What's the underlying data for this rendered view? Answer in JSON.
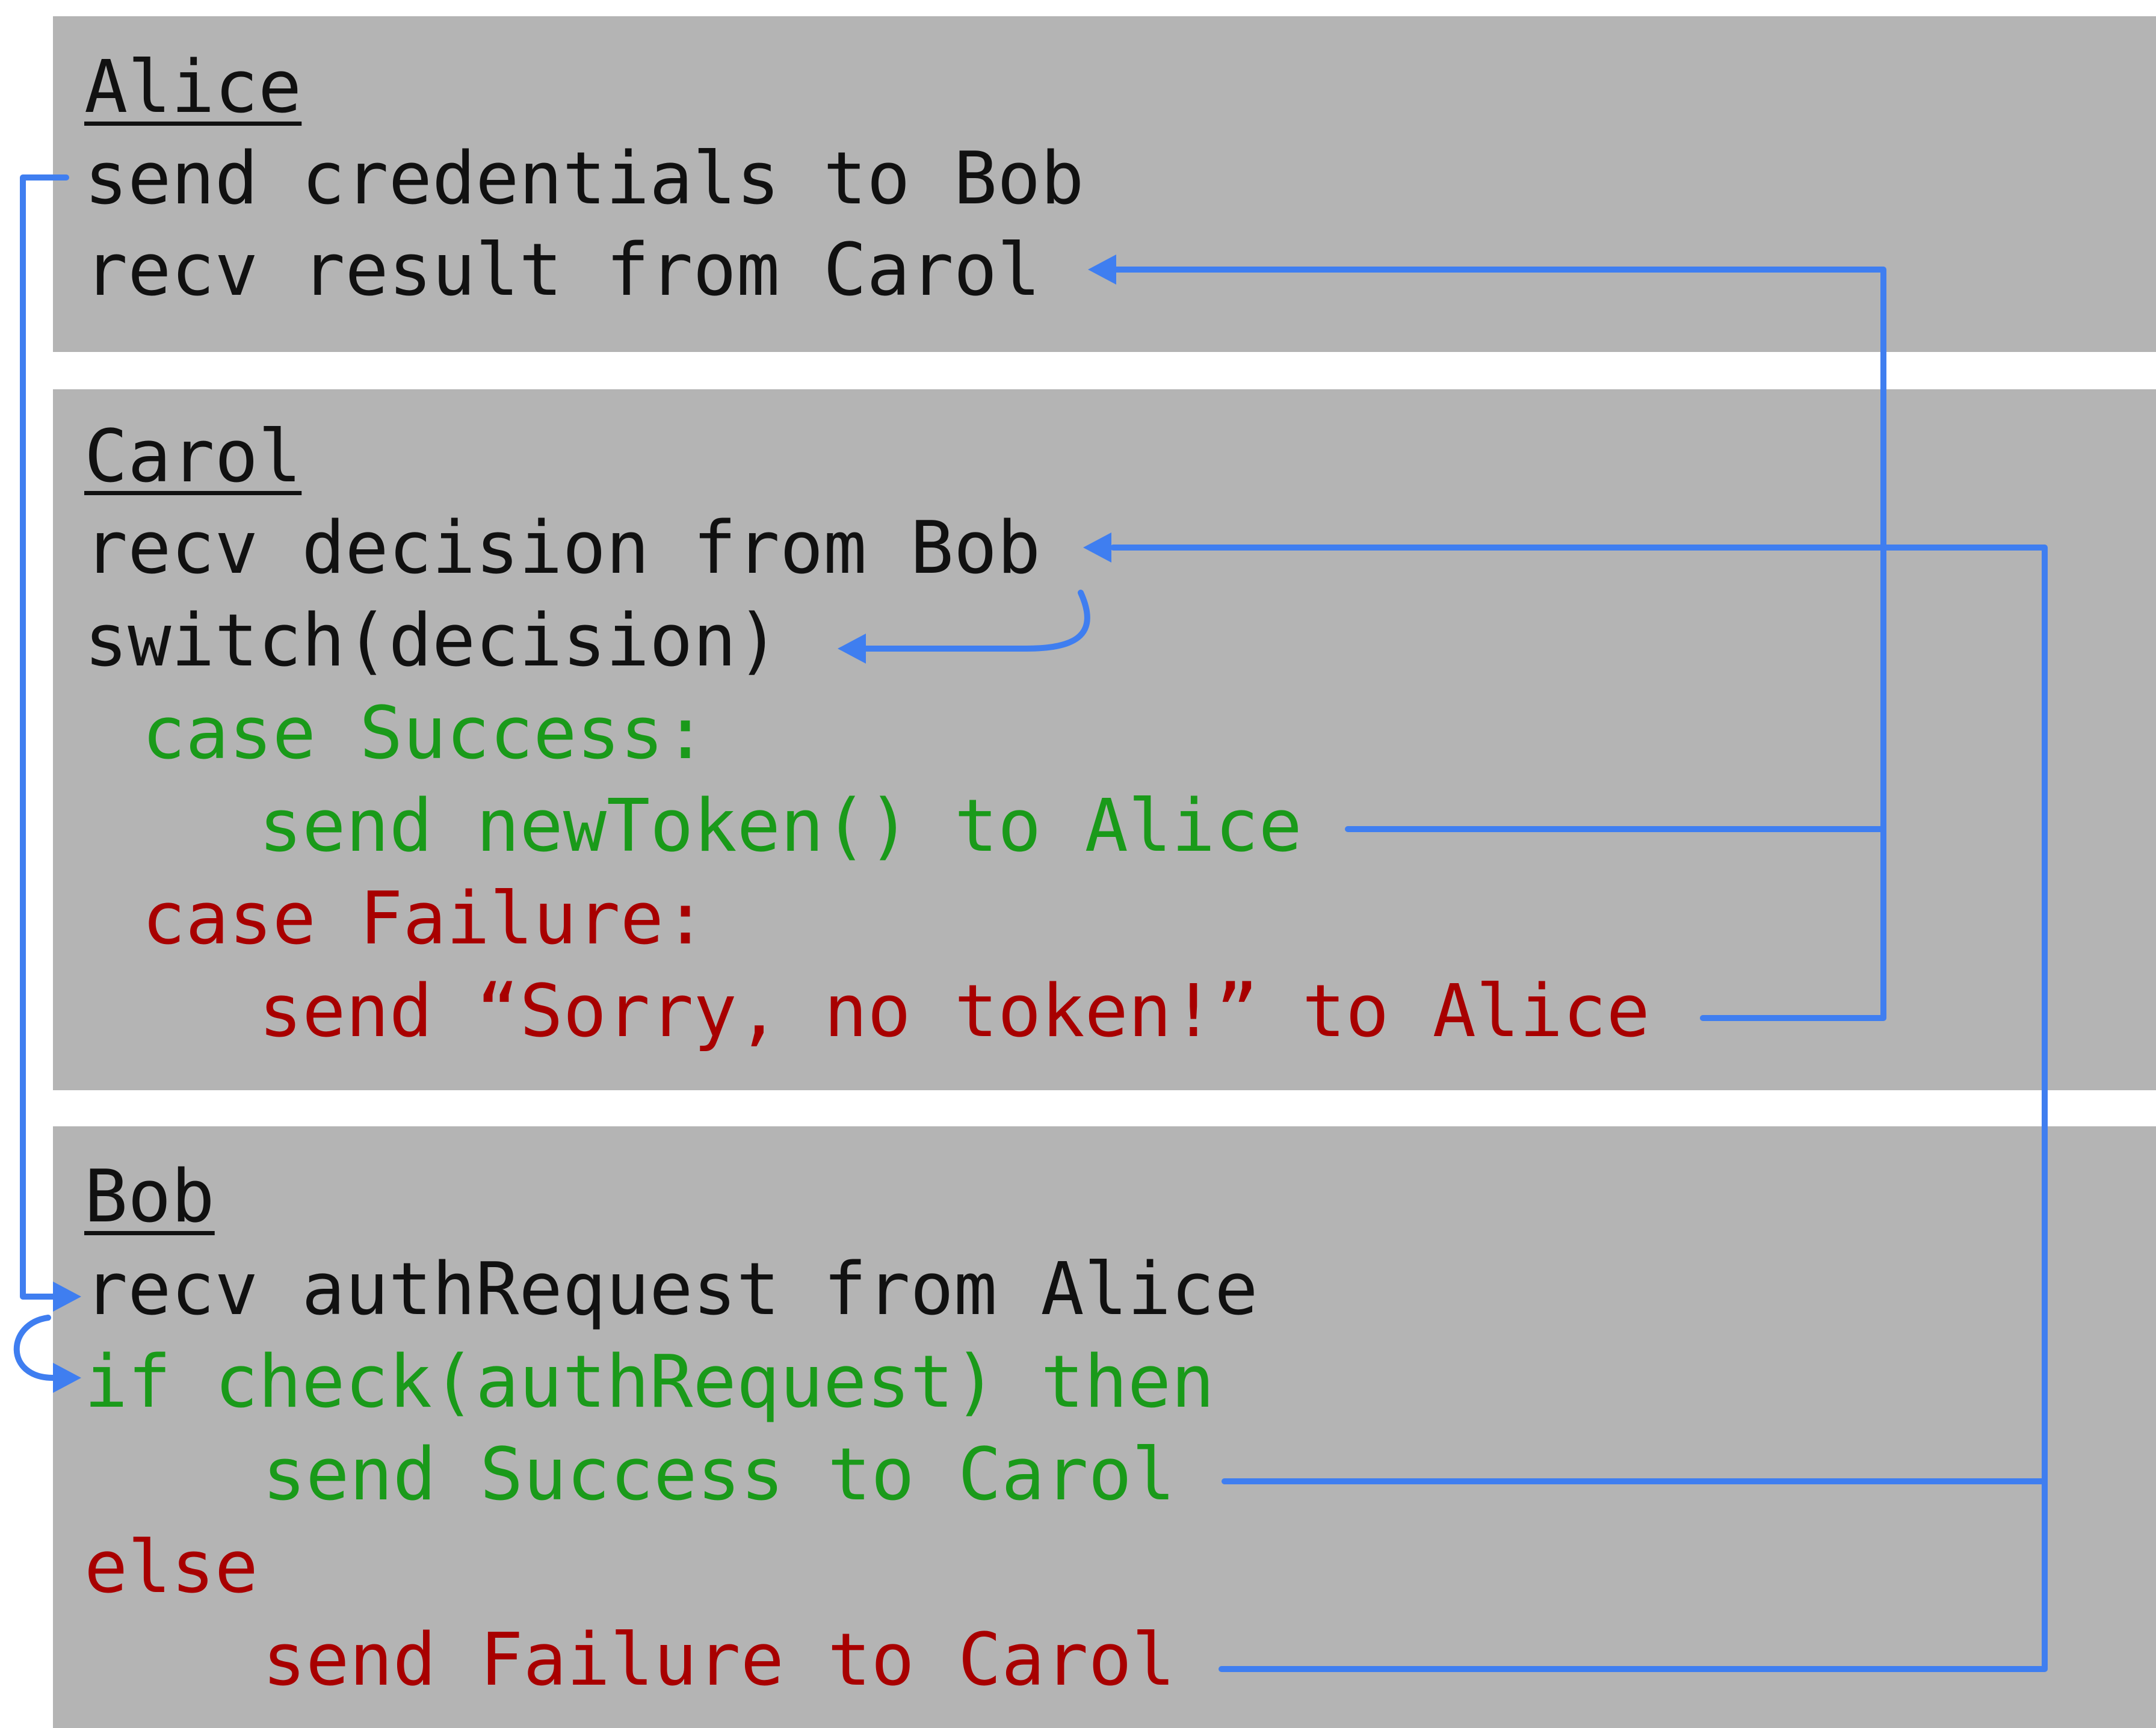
{
  "colors": {
    "panel": "#b4b4b4",
    "text": "#111111",
    "green": "#1a9a1a",
    "red": "#a80000",
    "arrow": "#3f7ef0"
  },
  "alice": {
    "title": "Alice",
    "lines": [
      "send credentials to Bob",
      "recv result from Carol"
    ]
  },
  "carol": {
    "title": "Carol",
    "lines": [
      "recv decision from Bob",
      "switch(decision)",
      "case Success:",
      "send newToken() to Alice",
      "case Failure:",
      "send “Sorry, no token!” to Alice"
    ]
  },
  "bob": {
    "title": "Bob",
    "lines": [
      "recv authRequest from Alice",
      "if check(authRequest) then",
      "send Success to Carol",
      "else",
      "send Failure to Carol"
    ]
  }
}
